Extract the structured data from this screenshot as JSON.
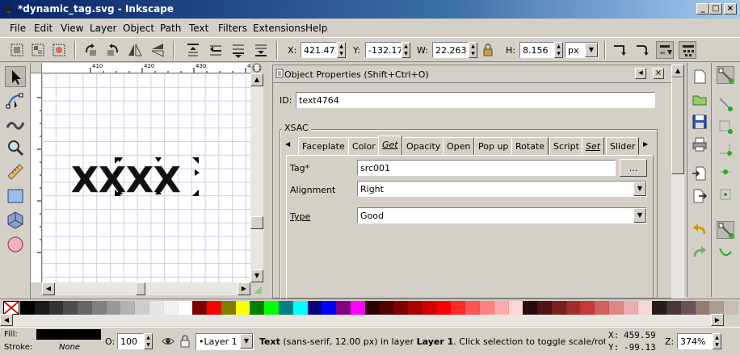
{
  "window": {
    "title": "*dynamic_tag.svg - Inkscape",
    "minimize": "_",
    "maximize": "□",
    "close": "×"
  },
  "menu": [
    "File",
    "Edit",
    "View",
    "Layer",
    "Object",
    "Path",
    "Text",
    "Filters",
    "Extensions",
    "Help"
  ],
  "toolbar": {
    "x_label": "X:",
    "x_value": "421.471",
    "y_label": "Y:",
    "y_value": "-132.17",
    "w_label": "W:",
    "w_value": "22.263",
    "h_label": "H:",
    "h_value": "8.156",
    "unit": "px"
  },
  "rulers": {
    "top_ticks": [
      "410",
      "420",
      "430",
      "440"
    ]
  },
  "canvas": {
    "text": "XXXX"
  },
  "dock": {
    "title": "Object Properties (Shift+Ctrl+O)",
    "id_label": "ID:",
    "id_value": "text4764",
    "group_label": "XSAC",
    "tabs": [
      {
        "label": "Faceplate",
        "active": false
      },
      {
        "label": "Color",
        "active": false
      },
      {
        "label": "Get",
        "active": true
      },
      {
        "label": "Opacity",
        "active": false
      },
      {
        "label": "Open",
        "active": false
      },
      {
        "label": "Pop up",
        "active": false
      },
      {
        "label": "Rotate",
        "active": false
      },
      {
        "label": "Script",
        "active": false
      },
      {
        "label": "Set",
        "active": false
      },
      {
        "label": "Slider",
        "active": false
      }
    ],
    "tag_label": "Tag*",
    "tag_value": "src001",
    "tag_button": "...",
    "alignment_label": "Alignment",
    "alignment_value": "Right",
    "type_label": "Type",
    "type_value": "Good"
  },
  "palette": [
    "#000000",
    "#1a1a1a",
    "#333333",
    "#4d4d4d",
    "#666666",
    "#808080",
    "#999999",
    "#b3b3b3",
    "#cccccc",
    "#e6e6e6",
    "#f2f2f2",
    "#ffffff",
    "#800000",
    "#ff0000",
    "#808000",
    "#ffff00",
    "#008000",
    "#00ff00",
    "#008080",
    "#00ffff",
    "#000080",
    "#0000ff",
    "#800080",
    "#ff00ff",
    "#2b0000",
    "#550000",
    "#800000",
    "#aa0000",
    "#d40000",
    "#ff0000",
    "#ff2a2a",
    "#ff5555",
    "#ff8080",
    "#ffaaaa",
    "#ffd5d5",
    "#280b0b",
    "#501616",
    "#782121",
    "#a02c2c",
    "#c83737",
    "#d35f5f",
    "#de8787",
    "#e9afaf",
    "#f4d7d7",
    "#241c1c",
    "#483737",
    "#6c5353",
    "#917c6f",
    "#ac9d93",
    "#c8beb7"
  ],
  "status": {
    "fill_label": "Fill:",
    "stroke_label": "Stroke:",
    "stroke_value": "None",
    "opacity_label": "O:",
    "opacity_value": "100",
    "layer": "•Layer 1",
    "message_bold": "Text",
    "message_rest": " (sans-serif, 12.00 px) in layer ",
    "message_layer": "Layer 1",
    "message_tail": ". Click selection to toggle scale/rotation han",
    "cursor_x_label": "X:",
    "cursor_x": "459.59",
    "cursor_y_label": "Y:",
    "cursor_y": "-99.13",
    "zoom_label": "Z:",
    "zoom_value": "374%"
  }
}
